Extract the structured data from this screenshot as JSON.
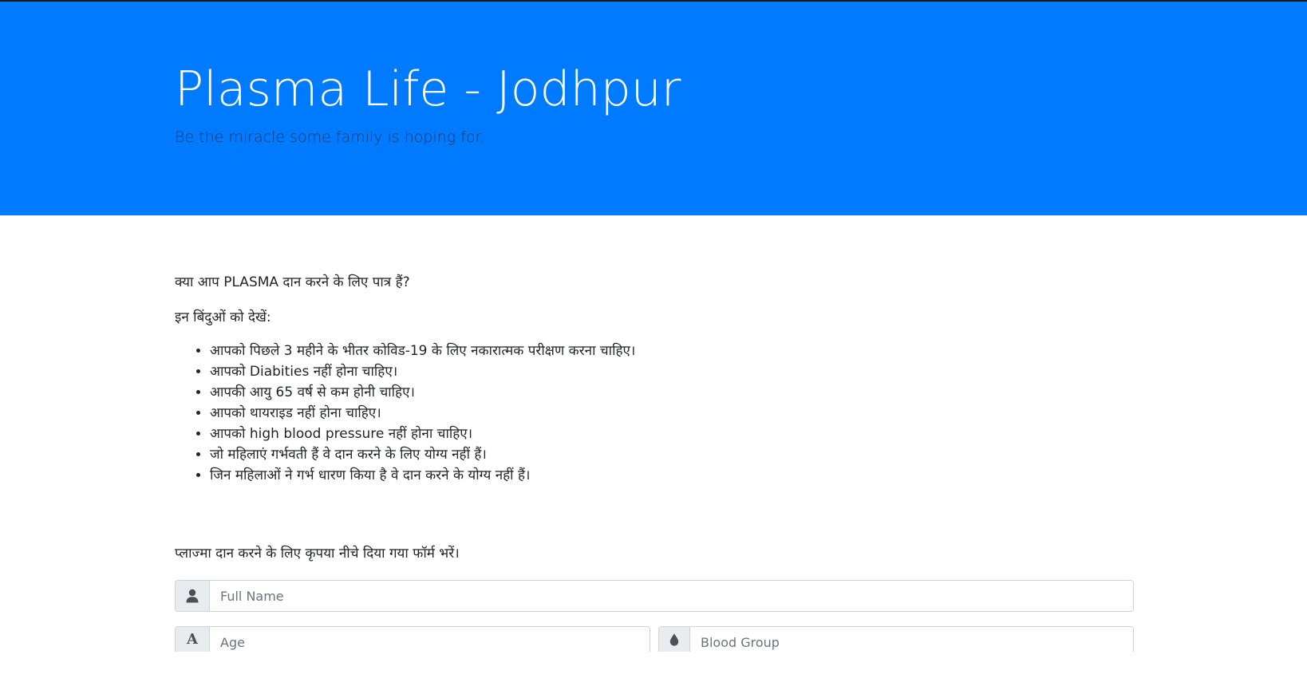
{
  "hero": {
    "title": "Plasma Life - Jodhpur",
    "tagline": "Be the miracle some family is hoping for."
  },
  "eligibility": {
    "question": "क्या आप PLASMA दान करने के लिए पात्र हैं?",
    "intro": "इन बिंदुओं को देखें:",
    "criteria": [
      "आपको पिछले 3 महीने के भीतर कोविड-19 के लिए नकारात्मक परीक्षण करना चाहिए।",
      "आपको Diabities नहीं होना चाहिए।",
      "आपकी आयु 65 वर्ष से कम होनी चाहिए।",
      "आपको थायराइड नहीं होना चाहिए।",
      "आपको high blood pressure नहीं होना चाहिए।",
      "जो महिलाएं गर्भवती हैं वे दान करने के लिए योग्य नहीं हैं।",
      "जिन महिलाओं ने गर्भ धारण किया है वे दान करने के योग्य नहीं हैं।"
    ]
  },
  "form": {
    "intro": "प्लाज्मा दान करने के लिए कृपया नीचे दिया गया फॉर्म भरें।",
    "full_name": {
      "placeholder": "Full Name",
      "icon": "user-icon"
    },
    "age": {
      "placeholder": "Age",
      "icon": "letter-a-icon",
      "icon_text": "A"
    },
    "blood_group": {
      "placeholder": "Blood Group",
      "icon": "blood-drop-icon"
    }
  },
  "colors": {
    "hero_bg": "#007bff",
    "addon_bg": "#e9ecef"
  }
}
